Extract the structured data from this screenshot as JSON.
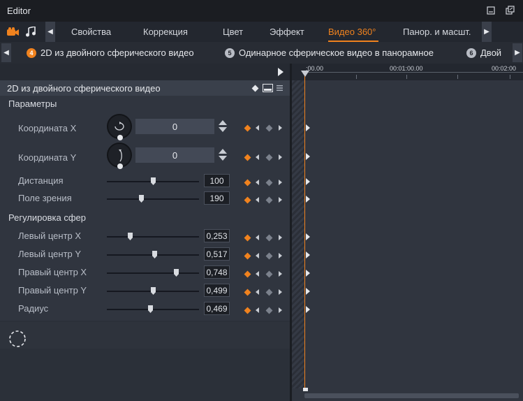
{
  "window": {
    "title": "Editor",
    "minimize_icon": "minimize-icon",
    "restore_icon": "restore-icon"
  },
  "tabs": [
    {
      "label": "Свойства"
    },
    {
      "label": "Коррекция"
    },
    {
      "label": "Цвет"
    },
    {
      "label": "Эффект"
    },
    {
      "label": "Видео 360°",
      "active": true
    },
    {
      "label": "Панор. и масшт."
    }
  ],
  "presets": [
    {
      "num": "4",
      "label": "2D из двойного сферического видео",
      "active": true
    },
    {
      "num": "5",
      "label": "Одинарное сферическое видео в панорамное"
    },
    {
      "num": "6",
      "label": "Двой"
    }
  ],
  "panel": {
    "title": "2D из двойного сферического видео"
  },
  "sections": {
    "params": "Параметры",
    "spheres": "Регулировка сфер"
  },
  "coords": [
    {
      "label": "Координата X",
      "value": "0"
    },
    {
      "label": "Координата Y",
      "value": "0"
    }
  ],
  "sliders": [
    {
      "label": "Дистанция",
      "value": "100",
      "level": 0.5
    },
    {
      "label": "Поле зрения",
      "value": "190",
      "level": 0.37
    },
    {
      "label": "Левый центр X",
      "value": "0,253",
      "level": 0.253
    },
    {
      "label": "Левый центр Y",
      "value": "0,517",
      "level": 0.517
    },
    {
      "label": "Правый центр X",
      "value": "0,748",
      "level": 0.748
    },
    {
      "label": "Правый центр Y",
      "value": "0,499",
      "level": 0.499
    },
    {
      "label": "Радиус",
      "value": "0,469",
      "level": 0.469
    }
  ],
  "timeline": {
    "ticks": [
      ":00.00",
      "00:01:00.00",
      "00:02:00"
    ]
  },
  "colors": {
    "accent": "#f0821e"
  }
}
